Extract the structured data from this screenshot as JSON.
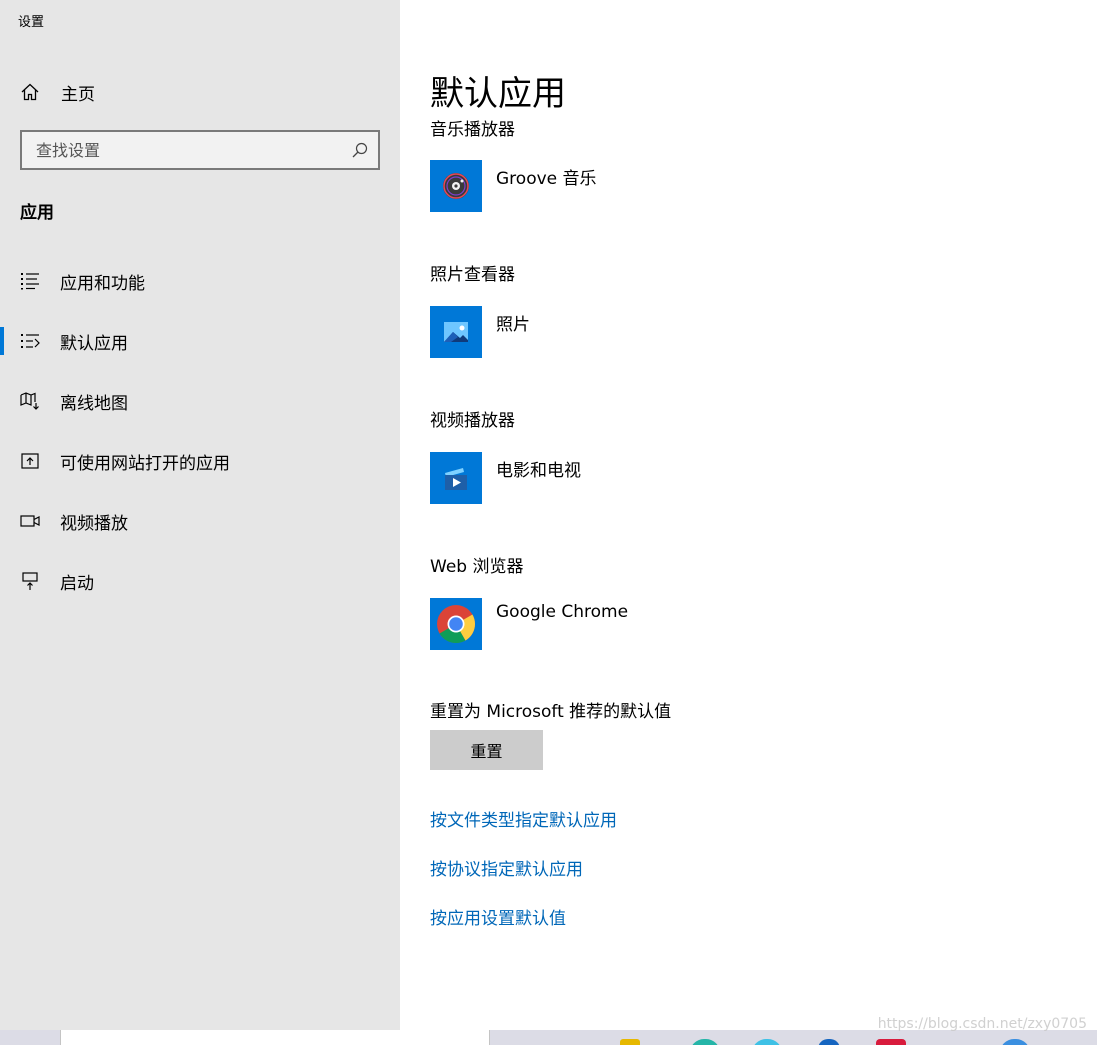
{
  "window": {
    "title": "设置"
  },
  "sidebar": {
    "home_label": "主页",
    "search_placeholder": "查找设置",
    "section": "应用",
    "items": [
      {
        "label": "应用和功能",
        "icon": "list-icon",
        "selected": false
      },
      {
        "label": "默认应用",
        "icon": "default-list-icon",
        "selected": true
      },
      {
        "label": "离线地图",
        "icon": "map-download-icon",
        "selected": false
      },
      {
        "label": "可使用网站打开的应用",
        "icon": "open-website-icon",
        "selected": false
      },
      {
        "label": "视频播放",
        "icon": "video-camera-icon",
        "selected": false
      },
      {
        "label": "启动",
        "icon": "startup-icon",
        "selected": false
      }
    ]
  },
  "main": {
    "title": "默认应用",
    "groups": [
      {
        "label": "音乐播放器",
        "app": "Groove 音乐",
        "icon": "groove-music-icon"
      },
      {
        "label": "照片查看器",
        "app": "照片",
        "icon": "photos-icon"
      },
      {
        "label": "视频播放器",
        "app": "电影和电视",
        "icon": "movies-tv-icon"
      },
      {
        "label": "Web 浏览器",
        "app": "Google Chrome",
        "icon": "chrome-icon"
      }
    ],
    "reset_label": "重置为 Microsoft 推荐的默认值",
    "reset_button": "重置",
    "links": [
      "按文件类型指定默认应用",
      "按协议指定默认应用",
      "按应用设置默认值"
    ]
  },
  "watermark": "https://blog.csdn.net/zxy0705",
  "colors": {
    "accent": "#0078d7",
    "link": "#0067b8",
    "sidebar_bg": "#e6e6e6",
    "button_bg": "#cccccc"
  }
}
